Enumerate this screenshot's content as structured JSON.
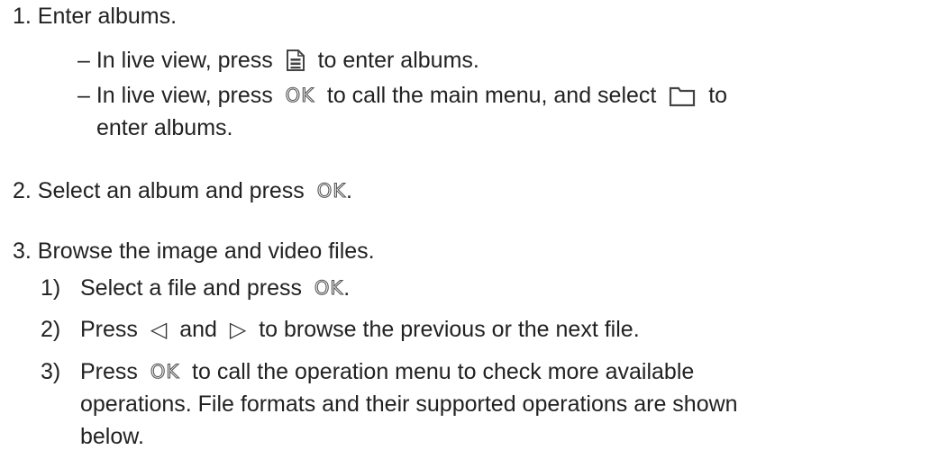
{
  "steps": {
    "step1": {
      "text": "1. Enter albums.",
      "sub1": {
        "before": "– In live view, press",
        "icon": "album-file-icon",
        "after": "to enter albums."
      },
      "sub2": {
        "before": "– In live view, press",
        "button": "OK",
        "middle": "to call the main menu, and select",
        "icon": "folder-icon",
        "after": "to",
        "continuation": "enter albums."
      }
    },
    "step2": {
      "before": "2. Select an album and press",
      "button": "OK",
      "after": "."
    },
    "step3": {
      "text": "3. Browse the image and video files.",
      "item1": {
        "num": "1)",
        "before": "Select a file and press",
        "button": "OK",
        "after": "."
      },
      "item2": {
        "num": "2)",
        "before": "Press",
        "left_icon": "left-triangle-icon",
        "middle": "and",
        "right_icon": "right-triangle-icon",
        "after": "to browse the previous or the next file."
      },
      "item3": {
        "num": "3)",
        "before": "Press",
        "button": "OK",
        "line1": "to call the operation menu to check more available",
        "line2": "operations. File formats and their supported operations are shown",
        "line3": "below."
      }
    }
  },
  "glyphs": {
    "left_triangle": "◁",
    "right_triangle": "▷"
  }
}
